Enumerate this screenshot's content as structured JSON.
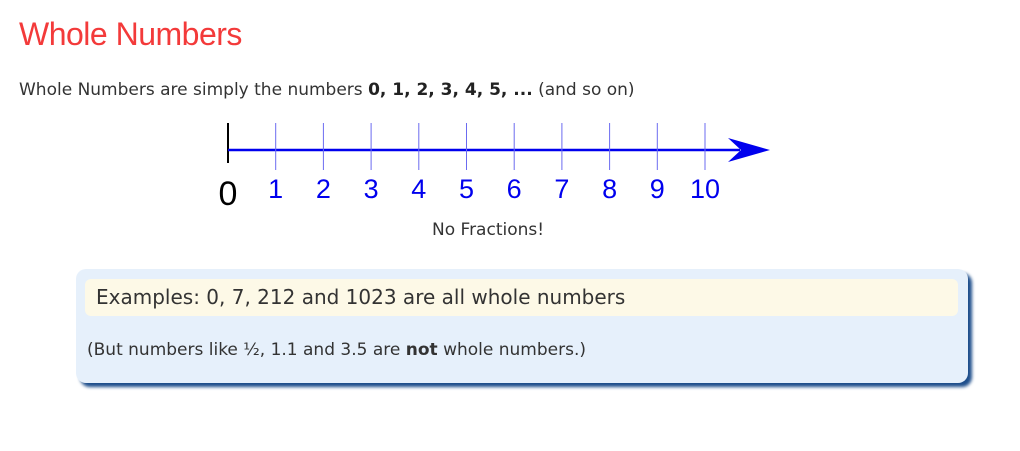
{
  "title": "Whole Numbers",
  "intro": {
    "before": "Whole Numbers are simply the numbers ",
    "emphasis": "0, 1, 2, 3, 4, 5, ...",
    "after": " (and so on)"
  },
  "number_line": {
    "labels": [
      "0",
      "1",
      "2",
      "3",
      "4",
      "5",
      "6",
      "7",
      "8",
      "9",
      "10"
    ],
    "caption": "No Fractions!",
    "line_color": "#0000ee",
    "zero_color": "#000000"
  },
  "examples_box": {
    "example": "Examples: 0, 7, 212 and 1023 are all whole numbers",
    "note_before": "(But numbers like ½, 1.1 and 3.5 are ",
    "note_emphasis": "not",
    "note_after": " whole numbers.)"
  },
  "colors": {
    "title": "#f33a3a",
    "box_bg": "#e6f0fb",
    "example_bg": "#fdf9e7",
    "shadow": "#1f4f8c"
  }
}
